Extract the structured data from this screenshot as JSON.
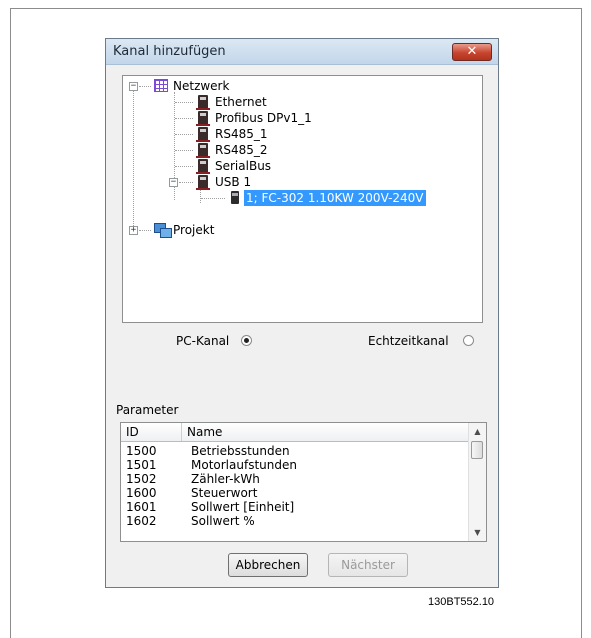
{
  "dialog": {
    "title": "Kanal hinzufügen",
    "close_symbol": "✕"
  },
  "tree": {
    "root": {
      "label": "Netzwerk",
      "expander": "−",
      "icon": "network-grid-icon"
    },
    "children": [
      {
        "label": "Ethernet",
        "icon": "drive-icon"
      },
      {
        "label": "Profibus DPv1_1",
        "icon": "drive-icon"
      },
      {
        "label": "RS485_1",
        "icon": "drive-icon"
      },
      {
        "label": "RS485_2",
        "icon": "drive-icon"
      },
      {
        "label": "SerialBus",
        "icon": "drive-icon"
      },
      {
        "label": "USB 1",
        "icon": "drive-icon",
        "expander": "−"
      }
    ],
    "usb_device": {
      "label": "1; FC-302 1.10KW 200V-240V",
      "selected": true,
      "icon": "device-icon"
    },
    "project": {
      "label": "Projekt",
      "expander": "+",
      "icon": "project-icon"
    }
  },
  "channel": {
    "pc_label": "PC-Kanal",
    "pc_checked": true,
    "realtime_label": "Echtzeitkanal",
    "realtime_checked": false
  },
  "parameters": {
    "label": "Parameter",
    "columns": [
      "ID",
      "Name"
    ],
    "rows": [
      {
        "id": "1500",
        "name": "Betriebsstunden"
      },
      {
        "id": "1501",
        "name": "Motorlaufstunden"
      },
      {
        "id": "1502",
        "name": "Zähler-kWh"
      },
      {
        "id": "1600",
        "name": "Steuerwort"
      },
      {
        "id": "1601",
        "name": "Sollwert [Einheit]"
      },
      {
        "id": "1602",
        "name": "Sollwert %"
      }
    ],
    "scroll_up": "▲",
    "scroll_down": "▼"
  },
  "buttons": {
    "cancel": "Abbrechen",
    "next": "Nächster",
    "next_disabled": true
  },
  "figure_code": "130BT552.10"
}
